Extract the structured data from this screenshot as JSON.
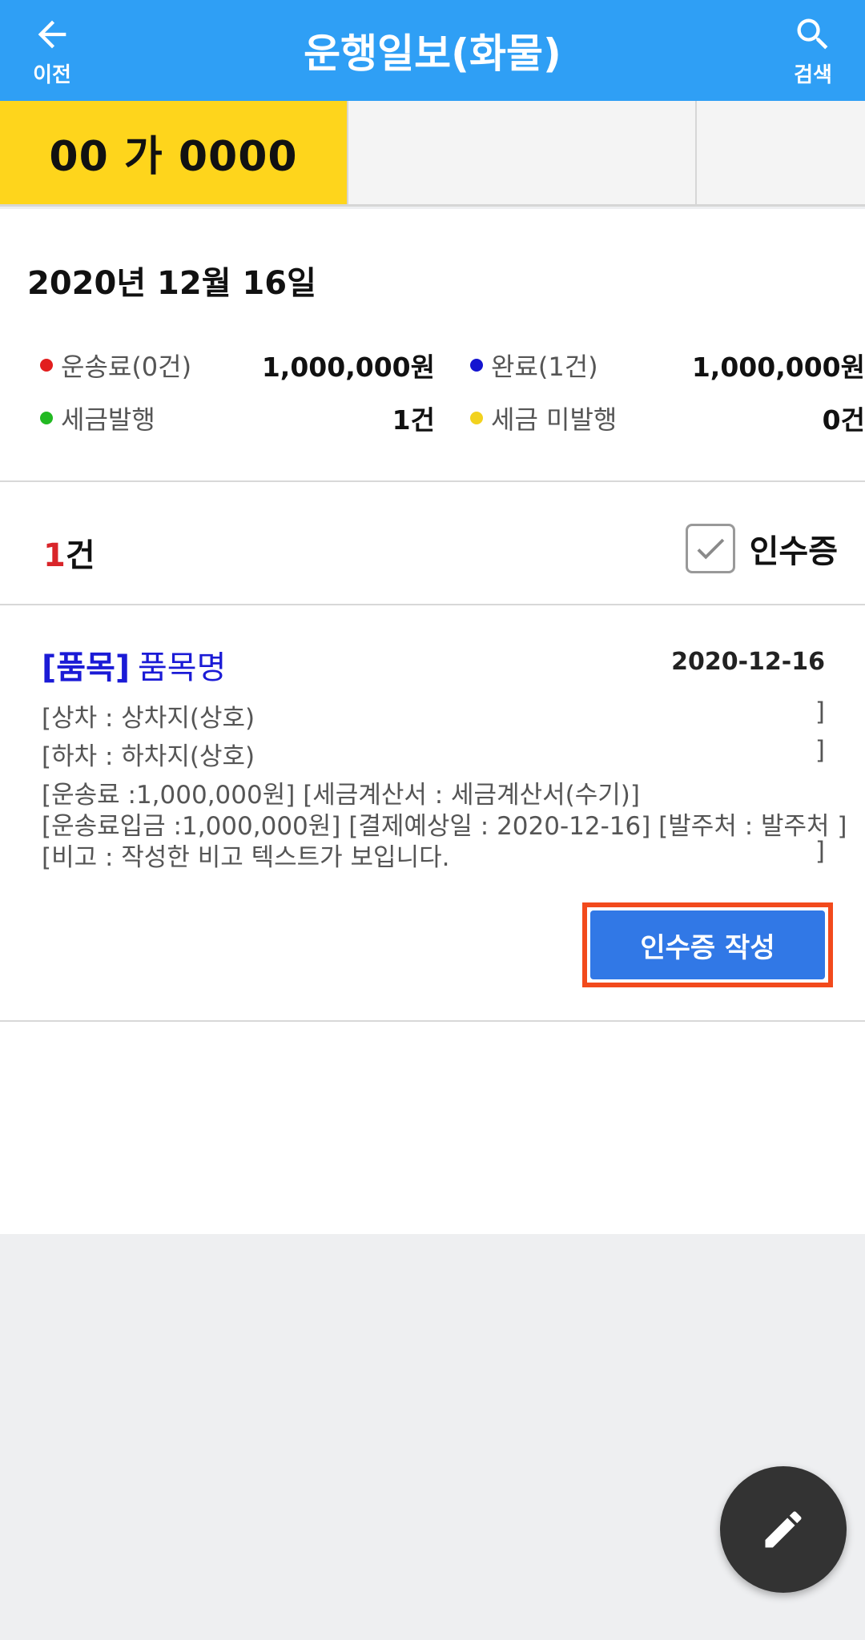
{
  "appbar": {
    "back_label": "이전",
    "title": "운행일보(화물)",
    "search_label": "검색"
  },
  "tabs": [
    {
      "label": "00 가 0000",
      "active": true
    },
    {
      "label": "",
      "active": false
    },
    {
      "label": "",
      "active": false
    }
  ],
  "date_title": "2020년 12월 16일",
  "summary": {
    "fare": {
      "label": "운송료(0건)",
      "value": "1,000,000원",
      "color": "#e21e1e"
    },
    "done": {
      "label": "완료(1건)",
      "value": "1,000,000원",
      "color": "#1414d0"
    },
    "tax_issued": {
      "label": "세금발행",
      "value": "1건",
      "color": "#22b922"
    },
    "tax_unissued": {
      "label": "세금 미발행",
      "value": "0건",
      "color": "#f2d21e"
    }
  },
  "list": {
    "count_num": "1",
    "count_unit": "건",
    "receipt_filter_label": "인수증",
    "receipt_filter_checked": true
  },
  "item": {
    "tag": "[품목]",
    "name": "품목명",
    "date": "2020-12-16",
    "loading": "[상차 : 상차지(상호)",
    "unloading": "[하차 : 하차지(상호)",
    "fare_line": "[운송료 :1,000,000원] [세금계산서 : 세금계산서(수기)]",
    "deposit_line": "[운송료입금 :1,000,000원] [결제예상일 : 2020-12-16] [발주처 : 발주처  ]",
    "note": "[비고 : 작성한 비고 텍스트가 보입니다.",
    "close_bracket": "]",
    "button_label": "인수증 작성"
  },
  "icons": {
    "back": "arrow-left-icon",
    "search": "search-icon",
    "fab": "pencil-icon",
    "check": "check-icon"
  },
  "colors": {
    "appbar": "#2f9ff5",
    "active_tab": "#fed51c",
    "button": "#3178e6",
    "highlight": "#f24a1c",
    "fab": "#333333"
  }
}
